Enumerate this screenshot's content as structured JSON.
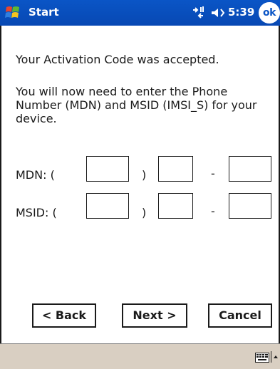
{
  "titlebar": {
    "title": "Start",
    "time": "5:39",
    "ok_label": "ok"
  },
  "content": {
    "message_accepted": "Your Activation Code was accepted.",
    "message_instructions": "You will now need to enter the Phone Number (MDN) and MSID (IMSI_S) for your device.",
    "mdn": {
      "label": "MDN: (",
      "close_paren": ")",
      "dash": "-",
      "part1": "",
      "part2": "",
      "part3": ""
    },
    "msid": {
      "label": "MSID: (",
      "close_paren": ")",
      "dash": "-",
      "part1": "",
      "part2": "",
      "part3": ""
    }
  },
  "buttons": {
    "back": "< Back",
    "next": "Next >",
    "cancel": "Cancel"
  },
  "icons": {
    "start": "windows-flag-icon",
    "connectivity": "connectivity-icon",
    "volume": "speaker-icon",
    "keyboard": "keyboard-icon",
    "sip": "up-arrow-icon"
  },
  "colors": {
    "titlebar": "#0a55c6",
    "bottombar": "#d9cfc2"
  }
}
